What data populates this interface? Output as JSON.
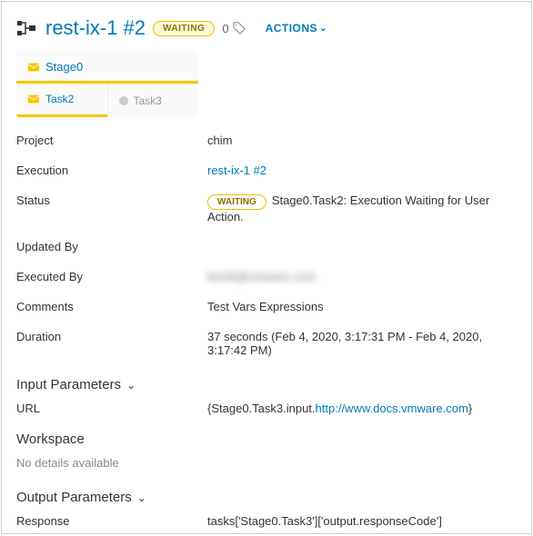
{
  "header": {
    "title": "rest-ix-1 #2",
    "status_badge": "WAITING",
    "tag_count": "0",
    "actions_label": "ACTIONS"
  },
  "stages": {
    "stage0_label": "Stage0",
    "task2_label": "Task2",
    "task3_label": "Task3"
  },
  "props": {
    "project_label": "Project",
    "project_value": "chim",
    "execution_label": "Execution",
    "execution_value": "rest-ix-1 #2",
    "status_label": "Status",
    "status_badge": "WAITING",
    "status_text": "Stage0.Task2: Execution Waiting for User Action.",
    "updated_by_label": "Updated By",
    "updated_by_value": "",
    "executed_by_label": "Executed By",
    "executed_by_value": "kerrib@vmware.com",
    "comments_label": "Comments",
    "comments_value": "Test Vars Expressions",
    "duration_label": "Duration",
    "duration_value": "37 seconds (Feb 4, 2020, 3:17:31 PM - Feb 4, 2020, 3:17:42 PM)"
  },
  "input_params": {
    "section_title": "Input Parameters",
    "url_label": "URL",
    "url_prefix": "{Stage0.Task3.input.",
    "url_link": "http://www.docs.vmware.com",
    "url_suffix": "}"
  },
  "workspace": {
    "section_title": "Workspace",
    "empty_text": "No details available"
  },
  "output_params": {
    "section_title": "Output Parameters",
    "response_label": "Response",
    "response_value": "tasks['Stage0.Task3']['output.responseCode']"
  }
}
